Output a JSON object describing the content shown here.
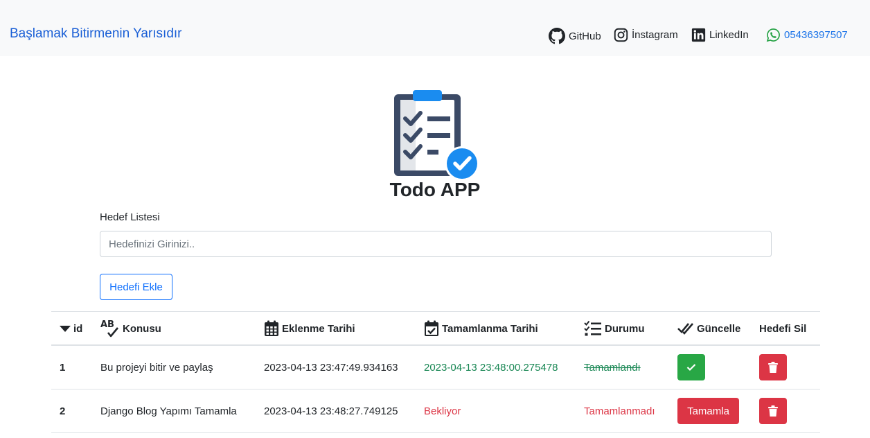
{
  "navbar": {
    "brand": "Başlamak Bitirmenin Yarısıdır",
    "links": {
      "github": "GitHub",
      "instagram": "İnstagram",
      "linkedin": "LinkedIn",
      "phone": "05436397507"
    }
  },
  "app": {
    "title": "Todo APP"
  },
  "form": {
    "label": "Hedef Listesi",
    "input_placeholder": "Hedefinizi Girinizi..",
    "input_value": "",
    "add_button": "Hedefi Ekle"
  },
  "table": {
    "headers": {
      "id": "id",
      "konu": "Konusu",
      "eklenme": "Eklenme Tarihi",
      "tamamlanma": "Tamamlanma Tarihi",
      "durum": "Durumu",
      "guncelle": "Güncelle",
      "sil": "Hedefi Sil"
    },
    "rows": [
      {
        "id": "1",
        "konu": "Bu projeyi bitir ve paylaş",
        "eklenme": "2023-04-13 23:47:49.934163",
        "tamamlanma": "2023-04-13 23:48:00.275478",
        "durum": "Tamamlandı"
      },
      {
        "id": "2",
        "konu": "Django Blog Yapımı Tamamla",
        "eklenme": "2023-04-13 23:48:27.749125",
        "tamamlanma": "Bekliyor",
        "durum": "Tamamlanmadı",
        "action": "Tamamla"
      }
    ]
  },
  "colors": {
    "brand": "#1a5fd6",
    "success": "#28a745",
    "danger": "#dc3545",
    "primary": "#0d6efd",
    "navbar_bg": "#f8f9fa"
  }
}
